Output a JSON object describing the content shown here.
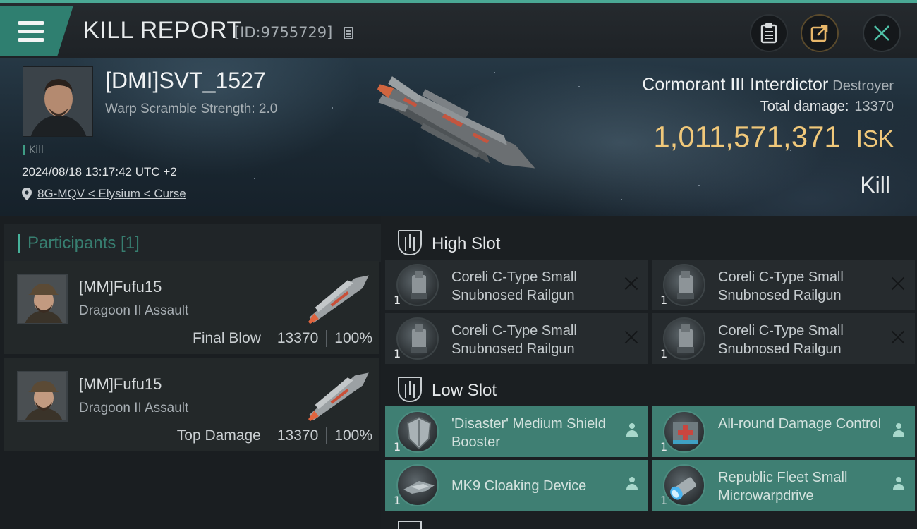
{
  "header": {
    "title": "KILL REPORT",
    "report_id": "[ID:9755729]"
  },
  "victim": {
    "name": "[DMI]SVT_1527",
    "subtitle": "Warp Scramble Strength: 2.0",
    "tag": "Kill",
    "datetime": "2024/08/18 13:17:42 UTC +2",
    "location": "8G-MQV < Elysium < Curse"
  },
  "ship": {
    "name": "Cormorant III Interdictor",
    "class": "Destroyer",
    "total_damage_label": "Total damage:",
    "total_damage": "13370",
    "isk_value": "1,011,571,371",
    "isk_unit": "ISK",
    "result": "Kill"
  },
  "participants": {
    "header": "Participants [1]",
    "rows": [
      {
        "name": "[MM]Fufu15",
        "ship": "Dragoon II Assault",
        "role": "Final Blow",
        "damage": "13370",
        "percent": "100%"
      },
      {
        "name": "[MM]Fufu15",
        "ship": "Dragoon II Assault",
        "role": "Top Damage",
        "damage": "13370",
        "percent": "100%"
      }
    ]
  },
  "fitting": {
    "high_slot_label": "High Slot",
    "low_slot_label": "Low Slot",
    "high": [
      {
        "qty": "1",
        "name": "Coreli C-Type Small Snubnosed Railgun"
      },
      {
        "qty": "1",
        "name": "Coreli C-Type Small Snubnosed Railgun"
      },
      {
        "qty": "1",
        "name": "Coreli C-Type Small Snubnosed Railgun"
      },
      {
        "qty": "1",
        "name": "Coreli C-Type Small Snubnosed Railgun"
      }
    ],
    "low": [
      {
        "qty": "1",
        "name": "'Disaster' Medium Shield Booster"
      },
      {
        "qty": "1",
        "name": "All-round Damage Control"
      },
      {
        "qty": "1",
        "name": "MK9 Cloaking Device"
      },
      {
        "qty": "1",
        "name": "Republic Fleet Small Microwarpdrive"
      }
    ]
  },
  "colors": {
    "accent": "#3f9c84",
    "isk_gold": "#f0c87a",
    "low_slot_bg": "#3f7f73"
  }
}
